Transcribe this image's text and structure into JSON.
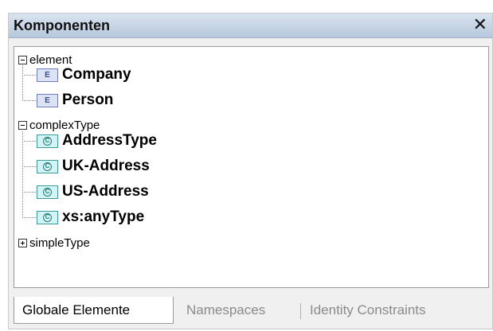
{
  "panel": {
    "title": "Komponenten",
    "close_glyph": "✕"
  },
  "tree": {
    "groups": [
      {
        "label": "element",
        "state": "expanded",
        "items": [
          {
            "badge": "E",
            "label": "Company"
          },
          {
            "badge": "E",
            "label": "Person"
          }
        ]
      },
      {
        "label": "complexType",
        "state": "expanded",
        "items": [
          {
            "badge": "C",
            "label": "AddressType"
          },
          {
            "badge": "C",
            "label": "UK-Address"
          },
          {
            "badge": "C",
            "label": "US-Address"
          },
          {
            "badge": "C",
            "label": "xs:anyType"
          }
        ]
      },
      {
        "label": "simpleType",
        "state": "collapsed",
        "items": []
      }
    ]
  },
  "tabs": [
    {
      "label": "Globale Elemente",
      "active": true
    },
    {
      "label": "Namespaces",
      "active": false
    },
    {
      "label": "Identity Constraints",
      "active": false
    }
  ],
  "colors": {
    "title_bar": "#c8d6e8",
    "element_badge": "#dde3f5",
    "complex_badge": "#d6f3f3"
  }
}
